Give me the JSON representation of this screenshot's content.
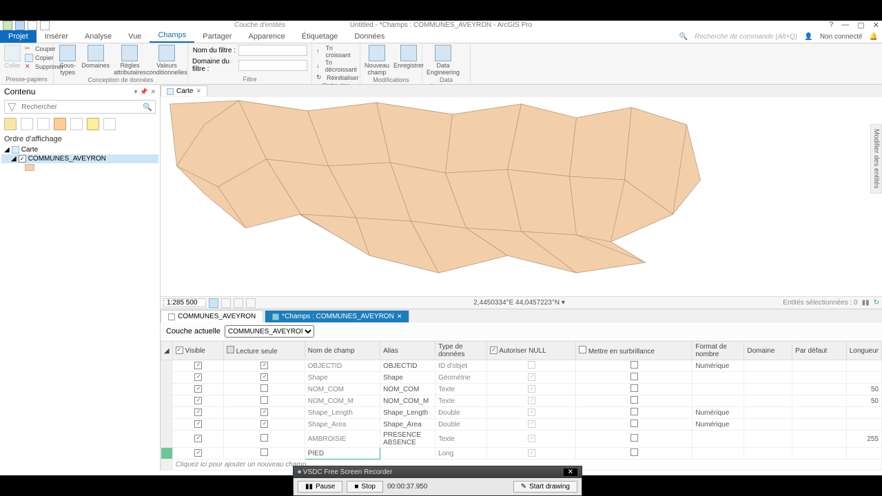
{
  "app": {
    "context_tab": "Couche d'entités",
    "title": "Untitled - *Champs : COMMUNES_AVEYRON - ArcGIS Pro",
    "search_placeholder": "Recherche de commande (Alt+Q)",
    "user_status": "Non connecté"
  },
  "tabs": [
    "Projet",
    "Insérer",
    "Analyse",
    "Vue",
    "Champs",
    "Partager",
    "Apparence",
    "Étiquetage",
    "Données"
  ],
  "ribbon": {
    "clipboard": {
      "paste": "Coller",
      "cut": "Couper",
      "copy": "Copier",
      "delete": "Supprimer",
      "label": "Presse-papiers"
    },
    "design": {
      "subtypes": "Sous-types",
      "domains": "Domaines",
      "attr_rules": "Règles\nattributaires",
      "cond_values": "Valeurs\nconditionnelles",
      "label": "Conception de données"
    },
    "filter": {
      "name": "Nom du filtre :",
      "domain": "Domaine du filtre :",
      "label": "Filtre"
    },
    "order": {
      "asc": "Tri croissant",
      "desc": "Tri décroissant",
      "reset": "Réinitialiser",
      "label": "Ordre des champs"
    },
    "mods": {
      "newfield": "Nouveau\nchamp",
      "save": "Enregistrer",
      "label": "Modifications"
    },
    "de": {
      "btn": "Data\nEngineering",
      "label": "Data Engineering"
    }
  },
  "contents": {
    "title": "Contenu",
    "search_placeholder": "Rechercher",
    "order_label": "Ordre d'affichage",
    "map_node": "Carte",
    "layer_node": "COMMUNES_AVEYRON"
  },
  "map": {
    "tab": "Carte",
    "scale": "1:285 500",
    "coords": "2,4450334°E 44,0457223°N",
    "sel_label": "Entités sélectionnées : 0"
  },
  "attr": {
    "tab1": "COMMUNES_AVEYRON",
    "tab2": "*Champs : COMMUNES_AVEYRON",
    "current_layer_label": "Couche actuelle",
    "current_layer": "COMMUNES_AVEYRON",
    "cols": [
      "",
      "Visible",
      "Lecture seule",
      "Nom de champ",
      "Alias",
      "Type de données",
      "Autoriser NULL",
      "Mettre en surbrillance",
      "Format de nombre",
      "Domaine",
      "Par défaut",
      "Longueur"
    ],
    "rows": [
      {
        "visible": true,
        "ro": true,
        "name": "OBJECTID",
        "alias": "OBJECTID",
        "type": "ID d'objet",
        "null": false,
        "hl": false,
        "fmt": "Numérique",
        "len": ""
      },
      {
        "visible": true,
        "ro": true,
        "name": "Shape",
        "alias": "Shape",
        "type": "Géométrie",
        "null": true,
        "hl": false,
        "fmt": "",
        "len": ""
      },
      {
        "visible": true,
        "ro": false,
        "name": "NOM_COM",
        "alias": "NOM_COM",
        "type": "Texte",
        "null": true,
        "hl": false,
        "fmt": "",
        "len": "50"
      },
      {
        "visible": true,
        "ro": false,
        "name": "NOM_COM_M",
        "alias": "NOM_COM_M",
        "type": "Texte",
        "null": true,
        "hl": false,
        "fmt": "",
        "len": "50"
      },
      {
        "visible": true,
        "ro": true,
        "name": "Shape_Length",
        "alias": "Shape_Length",
        "type": "Double",
        "null": true,
        "hl": false,
        "fmt": "Numérique",
        "len": ""
      },
      {
        "visible": true,
        "ro": true,
        "name": "Shape_Area",
        "alias": "Shape_Area",
        "type": "Double",
        "null": true,
        "hl": false,
        "fmt": "Numérique",
        "len": ""
      },
      {
        "visible": true,
        "ro": false,
        "name": "AMBROISIE",
        "alias": "PRESENCE ABSENCE",
        "type": "Texte",
        "null": true,
        "hl": false,
        "fmt": "",
        "len": "255"
      },
      {
        "visible": true,
        "ro": false,
        "name": "PIED",
        "alias": "",
        "type": "Long",
        "null": true,
        "hl": false,
        "fmt": "",
        "len": "",
        "editing": true
      }
    ],
    "newrow": "Cliquez ici pour ajouter un nouveau champ."
  },
  "recorder": {
    "title": "VSDC Free Screen Recorder",
    "pause": "Pause",
    "stop": "Stop",
    "time": "00:00:37.950",
    "draw": "Start drawing"
  },
  "vtab": "Modifier des entités"
}
